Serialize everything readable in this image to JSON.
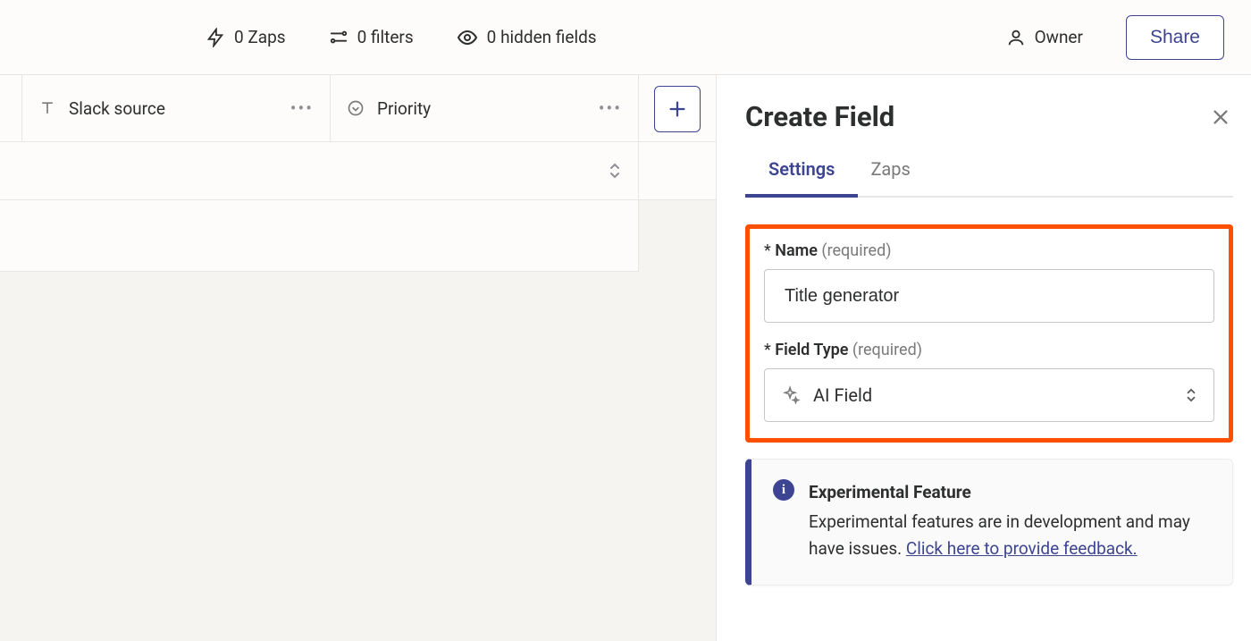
{
  "toolbar": {
    "zaps": "0 Zaps",
    "filters": "0 filters",
    "hidden_fields": "0 hidden fields",
    "owner": "Owner",
    "share": "Share"
  },
  "columns": [
    {
      "label": "Slack source",
      "type_icon": "text"
    },
    {
      "label": "Priority",
      "type_icon": "chevron-circle"
    }
  ],
  "panel": {
    "title": "Create Field",
    "tabs": {
      "settings": "Settings",
      "zaps": "Zaps"
    },
    "name_label": "Name",
    "name_required": "(required)",
    "name_value": "Title generator",
    "field_type_label": "Field Type",
    "field_type_required": "(required)",
    "field_type_value": "AI Field",
    "info_title": "Experimental Feature",
    "info_body": "Experimental features are in development and may have issues. ",
    "info_link": "Click here to provide feedback."
  }
}
